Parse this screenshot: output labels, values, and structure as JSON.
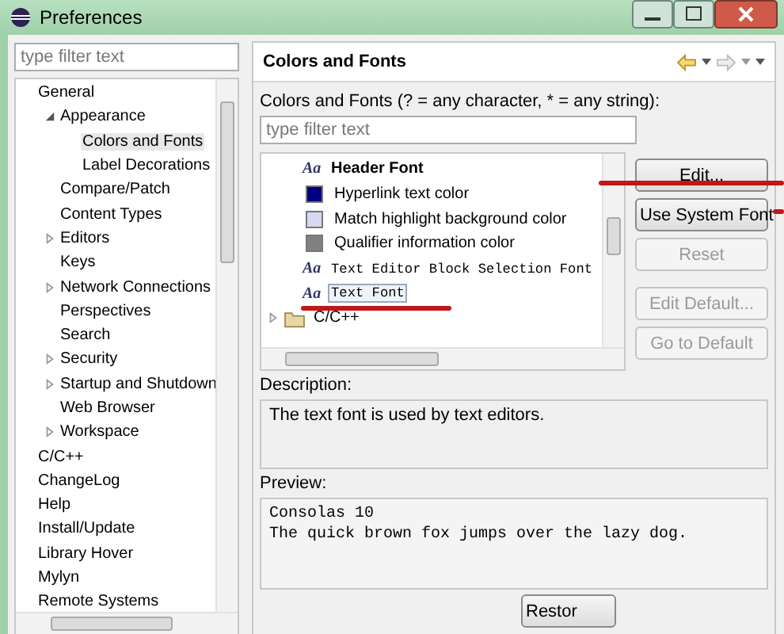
{
  "window": {
    "title": "Preferences"
  },
  "sidebar": {
    "filter": {
      "placeholder": "type filter text"
    },
    "items": [
      {
        "label": "General",
        "selected": false,
        "children": [
          {
            "label": "Appearance",
            "expanded": true,
            "selected": false,
            "children": [
              {
                "label": "Colors and Fonts",
                "selected": true
              },
              {
                "label": "Label Decorations",
                "selected": false
              }
            ]
          },
          {
            "label": "Compare/Patch",
            "selected": false
          },
          {
            "label": "Content Types",
            "selected": false
          },
          {
            "label": "Editors",
            "expanded": false,
            "selected": false
          },
          {
            "label": "Keys",
            "selected": false
          },
          {
            "label": "Network Connections",
            "expanded": false,
            "selected": false
          },
          {
            "label": "Perspectives",
            "selected": false
          },
          {
            "label": "Search",
            "selected": false
          },
          {
            "label": "Security",
            "expanded": false,
            "selected": false
          },
          {
            "label": "Startup and Shutdown",
            "expanded": false,
            "selected": false
          },
          {
            "label": "Web Browser",
            "selected": false
          },
          {
            "label": "Workspace",
            "expanded": false,
            "selected": false
          }
        ]
      },
      {
        "label": "C/C++",
        "selected": false
      },
      {
        "label": "ChangeLog",
        "selected": false
      },
      {
        "label": "Help",
        "selected": false
      },
      {
        "label": "Install/Update",
        "selected": false
      },
      {
        "label": "Library Hover",
        "selected": false
      },
      {
        "label": "Mylyn",
        "selected": false
      },
      {
        "label": "Remote Systems",
        "selected": false
      }
    ]
  },
  "page": {
    "title": "Colors and Fonts",
    "filter_label": "Colors and Fonts (? = any character, * = any string):",
    "filter": {
      "placeholder": "type filter text"
    },
    "items": [
      {
        "kind": "font",
        "icon": "Aa",
        "label": "Header Font",
        "bold": true,
        "mono": false,
        "selected": false
      },
      {
        "kind": "color",
        "label": "Hyperlink text color",
        "color": "#000080",
        "selected": false
      },
      {
        "kind": "color",
        "label": "Match highlight background color",
        "color": "#d8d8f0",
        "selected": false
      },
      {
        "kind": "color",
        "label": "Qualifier information color",
        "color": "#808080",
        "selected": false
      },
      {
        "kind": "font",
        "icon": "Aa",
        "label": "Text Editor Block Selection Font",
        "bold": false,
        "mono": true,
        "selected": false
      },
      {
        "kind": "font",
        "icon": "Aa",
        "label": "Text Font",
        "bold": false,
        "mono": true,
        "selected": true
      },
      {
        "kind": "category",
        "label": "C/C++",
        "selected": false
      }
    ],
    "buttons": [
      {
        "label": "Edit...",
        "disabled": false
      },
      {
        "label": "Use System Font",
        "disabled": false
      },
      {
        "label": "Reset",
        "disabled": true
      },
      {
        "label": "Edit Default...",
        "disabled": true
      },
      {
        "label": "Go to Default",
        "disabled": true
      }
    ],
    "description_label": "Description:",
    "description": "The text font is used by text editors.",
    "preview_label": "Preview:",
    "preview": [
      "Consolas 10",
      "The quick brown fox jumps over the lazy dog."
    ],
    "bottom_button": "Restor"
  }
}
